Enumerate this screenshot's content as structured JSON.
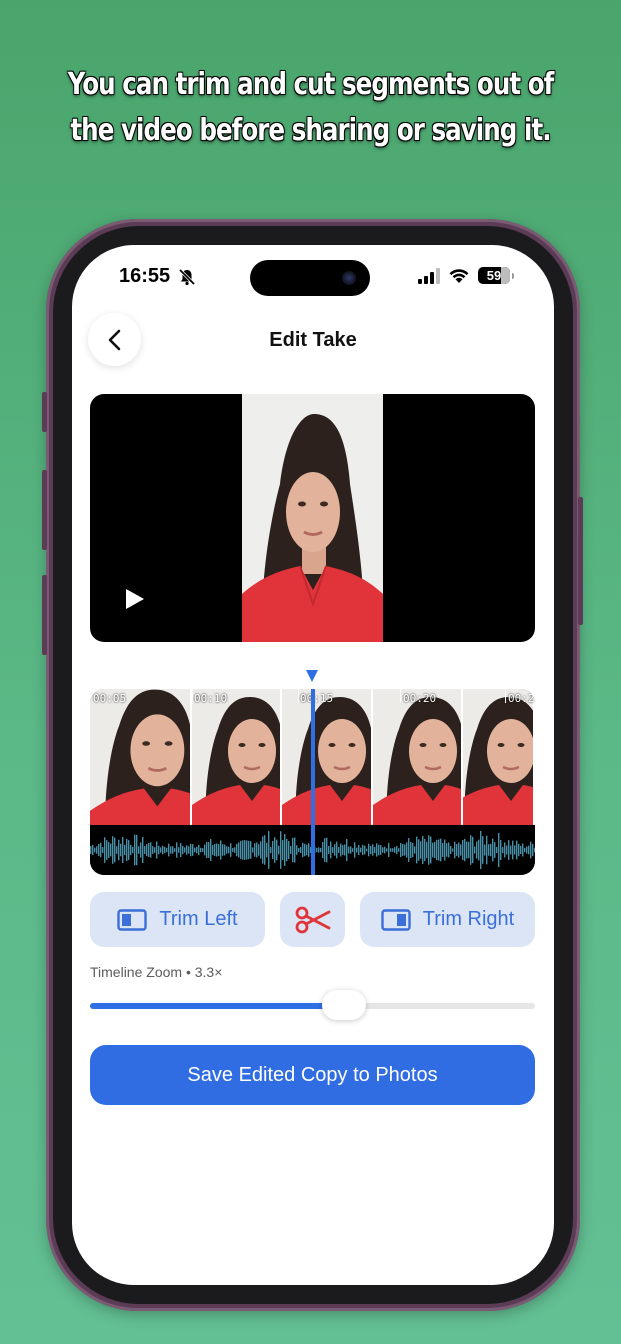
{
  "promo": {
    "headline_line1": "You can trim and cut segments out of",
    "headline_line2": "the video before sharing or saving it."
  },
  "status_bar": {
    "time": "16:55",
    "silent_icon": "bell-slash-icon",
    "signal_icon": "cellular-signal-icon",
    "wifi_icon": "wifi-icon",
    "battery_level": "59"
  },
  "nav": {
    "title": "Edit Take",
    "back_icon": "chevron-left-icon"
  },
  "player": {
    "play_icon": "play-icon"
  },
  "timeline": {
    "ticks": [
      "00:05",
      "00:10",
      "00:15",
      "00:20",
      "00:2"
    ],
    "playhead_icon": "triangle-down-icon"
  },
  "actions": {
    "trim_left_label": "Trim Left",
    "cut_icon": "scissors-icon",
    "trim_right_label": "Trim Right"
  },
  "zoom": {
    "label": "Timeline Zoom",
    "separator": "•",
    "value": "3.3×",
    "level_fraction": 0.57
  },
  "save_button_label": "Save Edited Copy to Photos",
  "colors": {
    "accent": "#306de3",
    "pill_bg": "#dbe5f6",
    "scissors": "#e0363a",
    "waveform": "#4a8fa7",
    "background_green": "#52ad77"
  }
}
